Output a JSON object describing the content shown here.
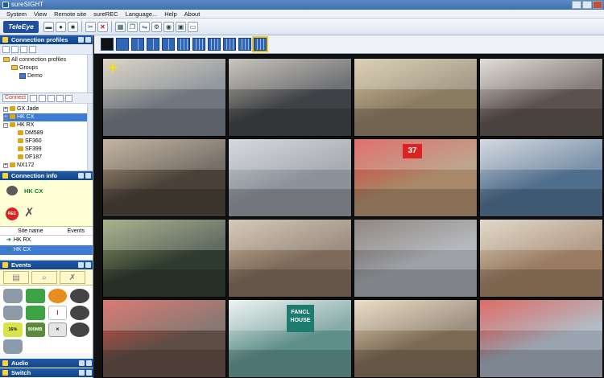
{
  "window": {
    "title": "sureSIGHT"
  },
  "menu": [
    "System",
    "View",
    "Remote site",
    "sureREC",
    "Language...",
    "Help",
    "About"
  ],
  "toolbar": {
    "logo": "TeleEye"
  },
  "panels": {
    "connection_profiles": "Connection profiles",
    "connect_label": "Connect",
    "connection_info": "Connection info",
    "events": "Events",
    "audio": "Audio",
    "switch": "Switch"
  },
  "profile_tree": [
    {
      "label": "All connection profiles",
      "level": 0,
      "icon": "folder"
    },
    {
      "label": "Groups",
      "level": 1,
      "icon": "folder"
    },
    {
      "label": "Demo",
      "level": 2,
      "icon": "grid"
    }
  ],
  "site_tree": [
    {
      "label": "GX Jade",
      "level": 0
    },
    {
      "label": "HK CX",
      "level": 0,
      "selected": true
    },
    {
      "label": "HK RX",
      "level": 0
    },
    {
      "label": "DM589",
      "level": 1
    },
    {
      "label": "SF360",
      "level": 1
    },
    {
      "label": "SF399",
      "level": 1
    },
    {
      "label": "DF187",
      "level": 1
    },
    {
      "label": "NX172",
      "level": 0
    }
  ],
  "connection_info": {
    "current_site": "HK CX",
    "rec_label": "REC",
    "col_site": "Site name",
    "col_events": "Events",
    "rows": [
      {
        "name": "HK RX",
        "selected": false
      },
      {
        "name": "HK CX",
        "selected": true
      }
    ]
  },
  "event_icons": [
    {
      "name": "database-icon",
      "label": ""
    },
    {
      "name": "disk-green-icon",
      "label": ""
    },
    {
      "name": "motion-alarm-icon",
      "label": ""
    },
    {
      "name": "camera-icon",
      "label": ""
    },
    {
      "name": "database-icon-2",
      "label": ""
    },
    {
      "name": "disk-green-icon-2",
      "label": ""
    },
    {
      "name": "thermometer-icon",
      "label": ""
    },
    {
      "name": "camera-dome-icon",
      "label": ""
    },
    {
      "name": "percent-disk-icon",
      "label": "16%"
    },
    {
      "name": "memory-icon",
      "label": "900MB"
    },
    {
      "name": "file-error-icon",
      "label": ""
    },
    {
      "name": "alert-icon",
      "label": ""
    },
    {
      "name": "database-icon-3",
      "label": ""
    }
  ],
  "video_tiles": [
    {
      "name": "camera-feed-1",
      "scene": "street facade",
      "base": "#6f7680",
      "accent": "#d0c7b4"
    },
    {
      "name": "camera-feed-2",
      "scene": "office",
      "base": "#3f4146",
      "accent": "#b7b2a6"
    },
    {
      "name": "camera-feed-3",
      "scene": "warehouse",
      "base": "#8a7b63",
      "accent": "#d1c29d"
    },
    {
      "name": "camera-feed-4",
      "scene": "train station",
      "base": "#5b514e",
      "accent": "#d8d3cd"
    },
    {
      "name": "camera-feed-5",
      "scene": "escalator mall",
      "base": "#4a4138",
      "accent": "#b19d83"
    },
    {
      "name": "camera-feed-6",
      "scene": "street sign",
      "base": "#8d9199",
      "accent": "#c8ccd2"
    },
    {
      "name": "camera-feed-7",
      "scene": "clothing store",
      "base": "#a88969",
      "accent": "#d73f3b"
    },
    {
      "name": "camera-feed-8",
      "scene": "food court",
      "base": "#4f6d8c",
      "accent": "#c7ccd6"
    },
    {
      "name": "camera-feed-9",
      "scene": "mall atrium",
      "base": "#2f3b2f",
      "accent": "#8e9966"
    },
    {
      "name": "camera-feed-10",
      "scene": "railway",
      "base": "#7d6a5a",
      "accent": "#c9b89d"
    },
    {
      "name": "camera-feed-11",
      "scene": "residential",
      "base": "#9ea2a8",
      "accent": "#6a5f57"
    },
    {
      "name": "camera-feed-12",
      "scene": "shopping arcade",
      "base": "#9a7c62",
      "accent": "#d9cdb8"
    },
    {
      "name": "camera-feed-13",
      "scene": "restaurant",
      "base": "#5e4d45",
      "accent": "#d04c45"
    },
    {
      "name": "camera-feed-14",
      "scene": "fancl house shop",
      "base": "#5f8f8a",
      "accent": "#e8f0ef"
    },
    {
      "name": "camera-feed-15",
      "scene": "mall hall",
      "base": "#7c6a55",
      "accent": "#e3d4b6"
    },
    {
      "name": "camera-feed-16",
      "scene": "gas station",
      "base": "#9aa4b1",
      "accent": "#d23a32"
    }
  ],
  "tile_text": {
    "shop_sign": "FANCL HOUSE",
    "store_sign": "37"
  }
}
